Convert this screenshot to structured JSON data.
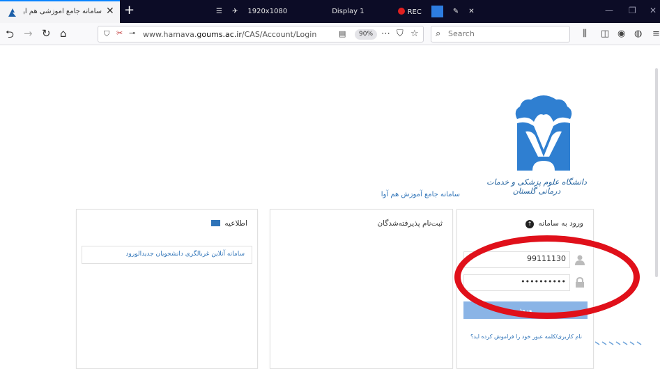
{
  "browser": {
    "tab_title": "سامانه جامع آموزشی هم آوا",
    "url_domain_prefix": "www.hamava.",
    "url_domain_main": "goums.ac.ir",
    "url_path": "/CAS/Account/Login",
    "zoom": "90%",
    "search_placeholder": "Search"
  },
  "recorder": {
    "resolution": "1920x1080",
    "display": "Display 1",
    "rec": "REC"
  },
  "page": {
    "university_name": "دانشگاه علوم پزشکی و خدمات درمانی گلستان",
    "system_title": "سامانه جامع آموزش هم آوا",
    "news_panel": {
      "title": "اطلاعیه",
      "items": [
        "سامانه آنلاین غربالگری دانشجویان جدیدالورود"
      ]
    },
    "registration_panel": {
      "title": "ثبت‌نام پذیرفته‌شدگان"
    },
    "login_panel": {
      "title": "ورود به سامانه",
      "username_value": "99111130",
      "password_value": "••••••••••",
      "login_button": "ورود",
      "forgot_link": "نام کاربری/کلمه عبور خود را فراموش کرده اید؟"
    }
  },
  "colors": {
    "accent": "#2e73b8",
    "button": "#8ab4e6",
    "annotation": "#e0101a"
  }
}
